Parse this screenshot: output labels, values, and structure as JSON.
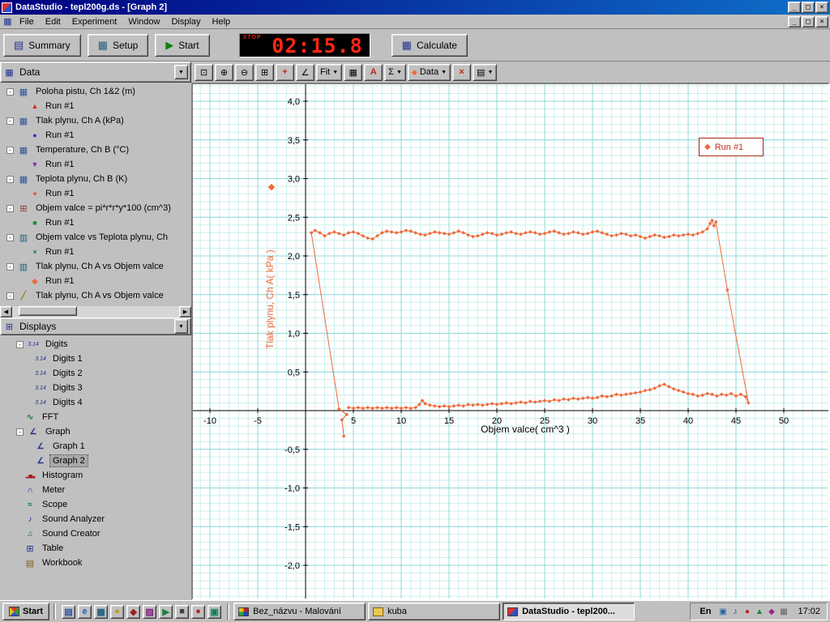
{
  "window": {
    "title": "DataStudio - tepl200g.ds - [Graph 2]",
    "controls": {
      "minimize": "_",
      "maximize": "□",
      "close": "×"
    }
  },
  "menu": {
    "items": [
      "File",
      "Edit",
      "Experiment",
      "Window",
      "Display",
      "Help"
    ]
  },
  "toolbar": {
    "summary_label": "Summary",
    "setup_label": "Setup",
    "start_label": "Start",
    "timer": {
      "indicator": "STOP",
      "value": "02:15.8"
    },
    "calculate_label": "Calculate"
  },
  "graph_toolbar": {
    "buttons": [
      {
        "name": "scale-to-fit-button",
        "glyph": "⊡"
      },
      {
        "name": "zoom-in-button",
        "glyph": "⊕"
      },
      {
        "name": "zoom-out-button",
        "glyph": "⊖"
      },
      {
        "name": "zoom-select-button",
        "glyph": "⊞"
      },
      {
        "name": "smart-tool-button",
        "glyph": "+",
        "color": "#c02818"
      },
      {
        "name": "slope-tool-button",
        "glyph": "∠"
      },
      {
        "name": "fit-menu-button",
        "glyph": "Fit",
        "dropdown": true
      },
      {
        "name": "calculate-tool-button",
        "glyph": "▦"
      },
      {
        "name": "text-annotation-button",
        "glyph": "A",
        "color": "#c02818"
      },
      {
        "name": "statistics-button",
        "glyph": "Σ",
        "dropdown": true
      },
      {
        "name": "data-menu-button",
        "glyph": "Data",
        "marker": "◆",
        "dropdown": true
      },
      {
        "name": "delete-button",
        "glyph": "×",
        "color": "#c02818"
      },
      {
        "name": "graph-settings-button",
        "glyph": "▤",
        "dropdown": true
      }
    ]
  },
  "sidebar": {
    "data_panel": {
      "title": "Data",
      "items": [
        {
          "kind": "parent",
          "icon": "sensor-icon",
          "label": "Poloha pistu, Ch 1&2 (m)"
        },
        {
          "kind": "run",
          "marker": "triangle-up",
          "color": "#d82820",
          "label": "Run #1"
        },
        {
          "kind": "parent",
          "icon": "sensor-icon",
          "label": "Tlak plynu, Ch A (kPa)"
        },
        {
          "kind": "run",
          "marker": "circle",
          "color": "#2334cc",
          "label": "Run #1"
        },
        {
          "kind": "parent",
          "icon": "sensor-icon",
          "label": "Temperature, Ch B (°C)"
        },
        {
          "kind": "run",
          "marker": "triangle-down",
          "color": "#8828a8",
          "label": "Run #1"
        },
        {
          "kind": "parent",
          "icon": "sensor-icon",
          "label": "Teplota plynu, Ch B (K)"
        },
        {
          "kind": "run",
          "marker": "plus",
          "color": "#d82820",
          "label": "Run #1"
        },
        {
          "kind": "parent",
          "icon": "calc-icon",
          "label": "Objem valce = pi*r*r*y*100 (cm^3)"
        },
        {
          "kind": "run",
          "marker": "square",
          "color": "#1f8f28",
          "label": "Run #1"
        },
        {
          "kind": "parent",
          "icon": "xy-icon",
          "label": "Objem valce vs Teplota plynu, Ch"
        },
        {
          "kind": "run",
          "marker": "x",
          "color": "#0f7f3f",
          "label": "Run #1"
        },
        {
          "kind": "parent",
          "icon": "xy-icon",
          "label": "Tlak plynu, Ch A vs Objem valce"
        },
        {
          "kind": "run",
          "marker": "diamond",
          "color": "#f0683a",
          "label": "Run #1"
        },
        {
          "kind": "parent",
          "icon": "pencil-icon",
          "label": "Tlak plynu, Ch A vs Objem valce"
        }
      ]
    },
    "displays_panel": {
      "title": "Displays",
      "items": [
        {
          "kind": "parent",
          "icon": "digits-icon",
          "label": "Digits"
        },
        {
          "kind": "child",
          "icon": "digits-icon",
          "label": "Digits 1"
        },
        {
          "kind": "child",
          "icon": "digits-icon",
          "label": "Digits 2"
        },
        {
          "kind": "child",
          "icon": "digits-icon",
          "label": "Digits 3"
        },
        {
          "kind": "child",
          "icon": "digits-icon",
          "label": "Digits 4"
        },
        {
          "kind": "leaf",
          "icon": "fft-icon",
          "label": "FFT"
        },
        {
          "kind": "parent",
          "icon": "graph-icon",
          "label": "Graph"
        },
        {
          "kind": "child",
          "icon": "graph-icon",
          "label": "Graph 1"
        },
        {
          "kind": "child",
          "icon": "graph-icon",
          "label": "Graph 2",
          "selected": true
        },
        {
          "kind": "leaf",
          "icon": "histogram-icon",
          "label": "Histogram"
        },
        {
          "kind": "leaf",
          "icon": "meter-icon",
          "label": "Meter"
        },
        {
          "kind": "leaf",
          "icon": "scope-icon",
          "label": "Scope"
        },
        {
          "kind": "leaf",
          "icon": "sound-analyzer-icon",
          "label": "Sound Analyzer"
        },
        {
          "kind": "leaf",
          "icon": "sound-creator-icon",
          "label": "Sound Creator"
        },
        {
          "kind": "leaf",
          "icon": "table-icon",
          "label": "Table"
        },
        {
          "kind": "leaf",
          "icon": "workbook-icon",
          "label": "Workbook"
        }
      ]
    }
  },
  "chart_data": {
    "type": "scatter",
    "title": "",
    "xlabel": "Objem valce( cm^3 )",
    "ylabel": "Tlak plynu, Ch A( kPa )",
    "ylabel_color": "#ef6b3b",
    "background": "#ffffff",
    "grid_minor_color": "#cdeeed",
    "grid_major_color": "#8fd8d8",
    "axis_color": "#000000",
    "xlim": [
      -11.8,
      54.7
    ],
    "ylim": [
      -2.43,
      4.22
    ],
    "x_minor_step": 1,
    "y_minor_step": 0.1,
    "x_major_step": 5,
    "y_major_step": 0.5,
    "x_ticks": {
      "values": [
        -10,
        -5,
        5,
        10,
        15,
        20,
        25,
        30,
        35,
        40,
        45,
        50
      ],
      "labels": [
        "-10",
        "-5",
        "5",
        "10",
        "15",
        "20",
        "25",
        "30",
        "35",
        "40",
        "45",
        "50"
      ]
    },
    "y_ticks": {
      "values": [
        4,
        3.5,
        3,
        2.5,
        2,
        1.5,
        1,
        0.5,
        -0.5,
        -1,
        -1.5,
        -2
      ],
      "labels": [
        "4,0",
        "3,5",
        "3,0",
        "2,5",
        "2,0",
        "1,5",
        "1,0",
        "0,5",
        "-0,5",
        "-1,0",
        "-1,5",
        "-2,0"
      ]
    },
    "legend": {
      "position": "top-right"
    },
    "series": [
      {
        "name": "Run #1",
        "color": "#f0683a",
        "marker": "diamond",
        "points": [
          [
            4.0,
            -0.33
          ],
          [
            3.8,
            -0.12
          ],
          [
            4.3,
            -0.05
          ],
          [
            3.5,
            0.02
          ],
          [
            0.6,
            2.3
          ],
          [
            1.0,
            2.33
          ],
          [
            1.5,
            2.3
          ],
          [
            2.0,
            2.26
          ],
          [
            2.5,
            2.29
          ],
          [
            3.0,
            2.31
          ],
          [
            3.5,
            2.29
          ],
          [
            4.0,
            2.27
          ],
          [
            4.5,
            2.3
          ],
          [
            5.0,
            2.31
          ],
          [
            5.5,
            2.29
          ],
          [
            6.0,
            2.26
          ],
          [
            6.5,
            2.23
          ],
          [
            7.0,
            2.22
          ],
          [
            7.5,
            2.26
          ],
          [
            8.0,
            2.3
          ],
          [
            8.5,
            2.32
          ],
          [
            9.0,
            2.31
          ],
          [
            9.5,
            2.3
          ],
          [
            10.0,
            2.31
          ],
          [
            10.5,
            2.33
          ],
          [
            11.0,
            2.32
          ],
          [
            11.5,
            2.3
          ],
          [
            12.0,
            2.28
          ],
          [
            12.5,
            2.27
          ],
          [
            13.0,
            2.29
          ],
          [
            13.5,
            2.31
          ],
          [
            14.0,
            2.3
          ],
          [
            14.5,
            2.29
          ],
          [
            15.0,
            2.28
          ],
          [
            15.5,
            2.3
          ],
          [
            16.0,
            2.32
          ],
          [
            16.5,
            2.3
          ],
          [
            17.0,
            2.27
          ],
          [
            17.5,
            2.25
          ],
          [
            18.0,
            2.26
          ],
          [
            18.5,
            2.28
          ],
          [
            19.0,
            2.3
          ],
          [
            19.5,
            2.29
          ],
          [
            20.0,
            2.27
          ],
          [
            20.5,
            2.28
          ],
          [
            21.0,
            2.3
          ],
          [
            21.5,
            2.31
          ],
          [
            22.0,
            2.29
          ],
          [
            22.5,
            2.28
          ],
          [
            23.0,
            2.3
          ],
          [
            23.5,
            2.31
          ],
          [
            24.0,
            2.3
          ],
          [
            24.5,
            2.28
          ],
          [
            25.0,
            2.29
          ],
          [
            25.5,
            2.31
          ],
          [
            26.0,
            2.32
          ],
          [
            26.5,
            2.3
          ],
          [
            27.0,
            2.28
          ],
          [
            27.5,
            2.29
          ],
          [
            28.0,
            2.31
          ],
          [
            28.5,
            2.3
          ],
          [
            29.0,
            2.28
          ],
          [
            29.5,
            2.29
          ],
          [
            30.0,
            2.31
          ],
          [
            30.5,
            2.32
          ],
          [
            31.0,
            2.3
          ],
          [
            31.5,
            2.28
          ],
          [
            32.0,
            2.26
          ],
          [
            32.5,
            2.27
          ],
          [
            33.0,
            2.29
          ],
          [
            33.5,
            2.28
          ],
          [
            34.0,
            2.26
          ],
          [
            34.5,
            2.27
          ],
          [
            35.0,
            2.25
          ],
          [
            35.5,
            2.23
          ],
          [
            36.0,
            2.25
          ],
          [
            36.5,
            2.27
          ],
          [
            37.0,
            2.26
          ],
          [
            37.5,
            2.24
          ],
          [
            38.0,
            2.25
          ],
          [
            38.5,
            2.27
          ],
          [
            39.0,
            2.26
          ],
          [
            39.5,
            2.27
          ],
          [
            40.0,
            2.28
          ],
          [
            40.5,
            2.27
          ],
          [
            41.0,
            2.29
          ],
          [
            41.5,
            2.31
          ],
          [
            42.0,
            2.35
          ],
          [
            42.3,
            2.42
          ],
          [
            42.5,
            2.46
          ],
          [
            42.7,
            2.39
          ],
          [
            42.9,
            2.44
          ],
          [
            44.1,
            1.56
          ],
          [
            46.3,
            0.1
          ],
          [
            46.0,
            0.18
          ],
          [
            45.5,
            0.21
          ],
          [
            45.0,
            0.19
          ],
          [
            44.5,
            0.22
          ],
          [
            44.0,
            0.2
          ],
          [
            43.5,
            0.21
          ],
          [
            43.0,
            0.19
          ],
          [
            42.5,
            0.21
          ],
          [
            42.0,
            0.22
          ],
          [
            41.5,
            0.2
          ],
          [
            41.0,
            0.19
          ],
          [
            40.5,
            0.21
          ],
          [
            40.0,
            0.22
          ],
          [
            39.5,
            0.24
          ],
          [
            39.0,
            0.26
          ],
          [
            38.5,
            0.28
          ],
          [
            38.0,
            0.31
          ],
          [
            37.5,
            0.34
          ],
          [
            37.0,
            0.32
          ],
          [
            36.5,
            0.29
          ],
          [
            36.0,
            0.27
          ],
          [
            35.5,
            0.26
          ],
          [
            35.0,
            0.24
          ],
          [
            34.5,
            0.23
          ],
          [
            34.0,
            0.22
          ],
          [
            33.5,
            0.21
          ],
          [
            33.0,
            0.2
          ],
          [
            32.5,
            0.21
          ],
          [
            32.0,
            0.19
          ],
          [
            31.5,
            0.18
          ],
          [
            31.0,
            0.19
          ],
          [
            30.5,
            0.17
          ],
          [
            30.0,
            0.16
          ],
          [
            29.5,
            0.17
          ],
          [
            29.0,
            0.16
          ],
          [
            28.5,
            0.15
          ],
          [
            28.0,
            0.16
          ],
          [
            27.5,
            0.14
          ],
          [
            27.0,
            0.15
          ],
          [
            26.5,
            0.13
          ],
          [
            26.0,
            0.14
          ],
          [
            25.5,
            0.12
          ],
          [
            25.0,
            0.13
          ],
          [
            24.5,
            0.12
          ],
          [
            24.0,
            0.11
          ],
          [
            23.5,
            0.12
          ],
          [
            23.0,
            0.1
          ],
          [
            22.5,
            0.11
          ],
          [
            22.0,
            0.1
          ],
          [
            21.5,
            0.09
          ],
          [
            21.0,
            0.1
          ],
          [
            20.5,
            0.09
          ],
          [
            20.0,
            0.08
          ],
          [
            19.5,
            0.09
          ],
          [
            19.0,
            0.08
          ],
          [
            18.5,
            0.07
          ],
          [
            18.0,
            0.08
          ],
          [
            17.5,
            0.07
          ],
          [
            17.0,
            0.08
          ],
          [
            16.5,
            0.06
          ],
          [
            16.0,
            0.07
          ],
          [
            15.5,
            0.06
          ],
          [
            15.0,
            0.05
          ],
          [
            14.5,
            0.06
          ],
          [
            14.0,
            0.05
          ],
          [
            13.5,
            0.06
          ],
          [
            13.0,
            0.07
          ],
          [
            12.5,
            0.09
          ],
          [
            12.2,
            0.13
          ],
          [
            11.9,
            0.08
          ],
          [
            11.5,
            0.04
          ],
          [
            11.0,
            0.03
          ],
          [
            10.5,
            0.04
          ],
          [
            10.0,
            0.03
          ],
          [
            9.5,
            0.04
          ],
          [
            9.0,
            0.03
          ],
          [
            8.5,
            0.04
          ],
          [
            8.0,
            0.03
          ],
          [
            7.5,
            0.04
          ],
          [
            7.0,
            0.03
          ],
          [
            6.5,
            0.04
          ],
          [
            6.0,
            0.03
          ],
          [
            5.5,
            0.04
          ],
          [
            5.0,
            0.03
          ],
          [
            4.5,
            0.04
          ]
        ]
      }
    ]
  },
  "taskbar": {
    "start_label": "Start",
    "quick_launch": [
      {
        "glyph": "▤",
        "color": "#3050a0"
      },
      {
        "glyph": "e",
        "color": "#2060c0"
      },
      {
        "glyph": "▦",
        "color": "#206080"
      },
      {
        "glyph": "●",
        "color": "#c0a020"
      },
      {
        "glyph": "◆",
        "color": "#a02020"
      },
      {
        "glyph": "▨",
        "color": "#802080"
      },
      {
        "glyph": "▶",
        "color": "#208040"
      },
      {
        "glyph": "■",
        "color": "#404040"
      },
      {
        "glyph": "●",
        "color": "#c02020"
      },
      {
        "glyph": "▣",
        "color": "#108060"
      }
    ],
    "tasks": [
      {
        "label": "Bez_názvu - Malování",
        "icon": "paint-icon",
        "active": false
      },
      {
        "label": "kuba",
        "icon": "folder-icon",
        "active": false
      },
      {
        "label": "DataStudio - tepl200...",
        "icon": "datastudio-icon",
        "active": true
      }
    ],
    "tray": {
      "lang": "En",
      "icons": [
        {
          "glyph": "▣",
          "color": "#2060a0"
        },
        {
          "glyph": "♪",
          "color": "#204080"
        },
        {
          "glyph": "●",
          "color": "#c02020"
        },
        {
          "glyph": "▲",
          "color": "#208040"
        },
        {
          "glyph": "◆",
          "color": "#a02080"
        },
        {
          "glyph": "▦",
          "color": "#606060"
        }
      ],
      "clock": "17:02"
    }
  }
}
